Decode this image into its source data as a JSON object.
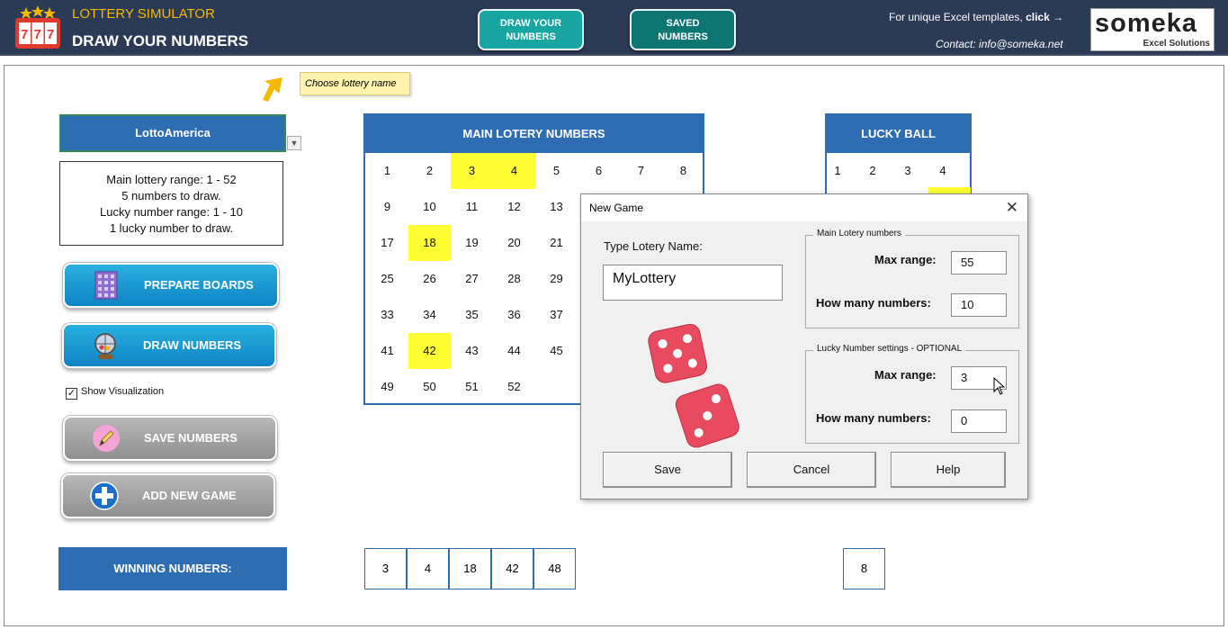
{
  "header": {
    "app_title": "LOTTERY SIMULATOR",
    "page_title": "DRAW YOUR NUMBERS",
    "nav_draw_line1": "DRAW YOUR",
    "nav_draw_line2": "NUMBERS",
    "nav_saved_line1": "SAVED",
    "nav_saved_line2": "NUMBERS",
    "templates_text": "For unique Excel templates, ",
    "templates_link": "click →",
    "contact": "Contact: info@someka.net",
    "logo_brand": "someka",
    "logo_sub": "Excel Solutions",
    "logo_digits": "777"
  },
  "tip": "Choose lottery name",
  "lottery": {
    "selected": "LottoAmerica",
    "info": [
      "Main lottery range: 1 - 52",
      "5 numbers to draw.",
      "Lucky number range: 1 - 10",
      "1 lucky number to draw."
    ]
  },
  "buttons": {
    "prepare": "PREPARE BOARDS",
    "draw": "DRAW NUMBERS",
    "save": "SAVE NUMBERS",
    "add": "ADD NEW GAME"
  },
  "show_visualization": {
    "label": "Show Visualization",
    "checked": true
  },
  "main_grid": {
    "title": "MAIN LOTERY NUMBERS",
    "visible_numbers": [
      1,
      2,
      3,
      4,
      5,
      6,
      7,
      8,
      9,
      10,
      11,
      12,
      13,
      17,
      18,
      19,
      20,
      21,
      25,
      26,
      27,
      28,
      29,
      33,
      34,
      35,
      36,
      37,
      41,
      42,
      43,
      44,
      45,
      49,
      50,
      51,
      52
    ],
    "highlighted": [
      3,
      4,
      18,
      42
    ]
  },
  "lucky_grid": {
    "title": "LUCKY BALL",
    "visible_numbers": [
      1,
      2,
      3,
      4
    ],
    "highlighted": [
      4
    ]
  },
  "winning": {
    "label": "WINNING NUMBERS:",
    "main": [
      "3",
      "4",
      "18",
      "42",
      "48"
    ],
    "lucky": [
      "8"
    ]
  },
  "dialog": {
    "title": "New Game",
    "close": "✕",
    "name_label": "Type Lotery Name:",
    "name_value": "MyLottery",
    "main_group": "Main Lotery numbers",
    "lucky_group": "Lucky Number settings - OPTIONAL",
    "max_range_label": "Max range:",
    "how_many_label": "How many numbers:",
    "main_max_range": "55",
    "main_how_many": "10",
    "lucky_max_range": "3",
    "lucky_how_many": "0",
    "save": "Save",
    "cancel": "Cancel",
    "help": "Help"
  },
  "colors": {
    "header_bg": "#2b3a55",
    "accent_blue": "#2f6db3",
    "highlight": "#ffff33",
    "teal": "#19a6a3",
    "gold": "#f5b800"
  }
}
